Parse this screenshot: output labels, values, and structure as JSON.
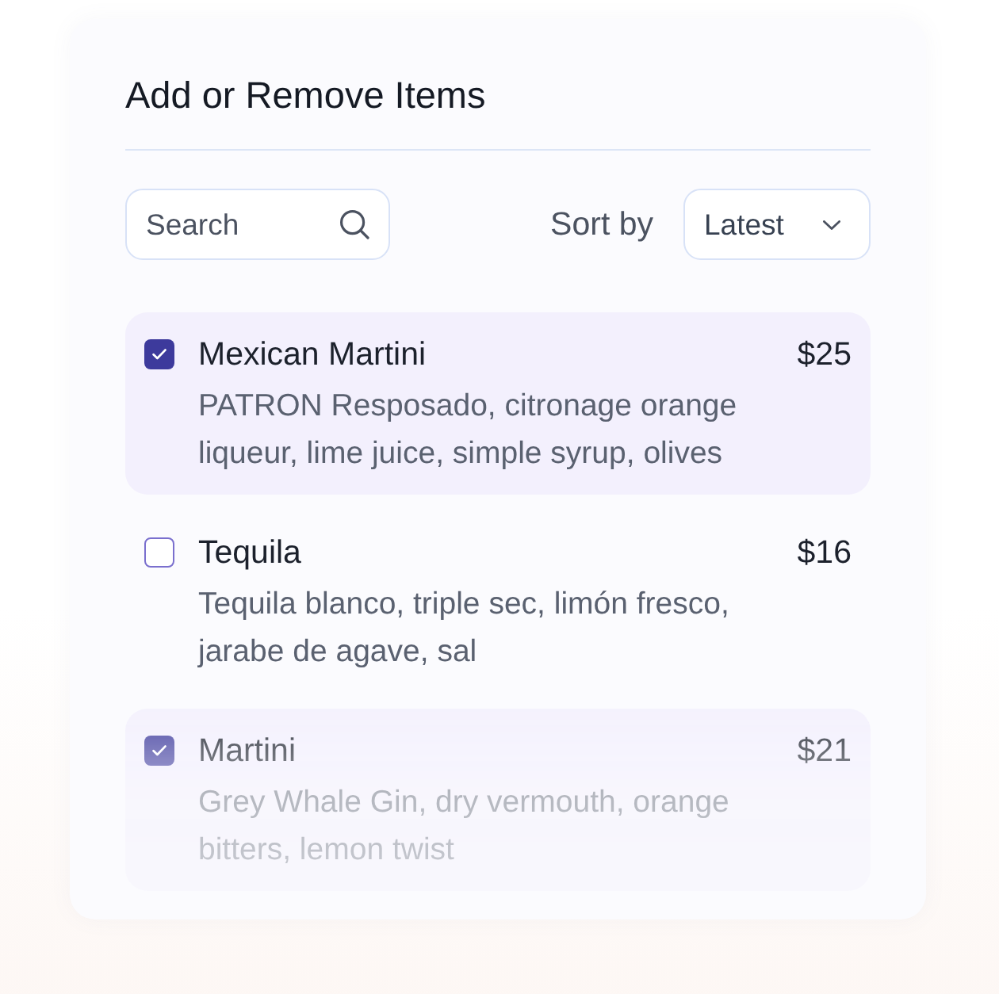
{
  "panel": {
    "title": "Add or Remove Items"
  },
  "search": {
    "placeholder": "Search"
  },
  "sort": {
    "label": "Sort by",
    "value": "Latest"
  },
  "items": [
    {
      "name": "Mexican Martini",
      "price": "$25",
      "description": "PATRON Resposado, citronage orange liqueur, lime juice, simple syrup, olives",
      "checked": true
    },
    {
      "name": "Tequila",
      "price": "$16",
      "description": "Tequila blanco, triple sec, limón fresco, jarabe de agave, sal",
      "checked": false
    },
    {
      "name": "Martini",
      "price": "$21",
      "description": "Grey Whale Gin, dry vermouth, orange bitters, lemon twist",
      "checked": true
    }
  ]
}
